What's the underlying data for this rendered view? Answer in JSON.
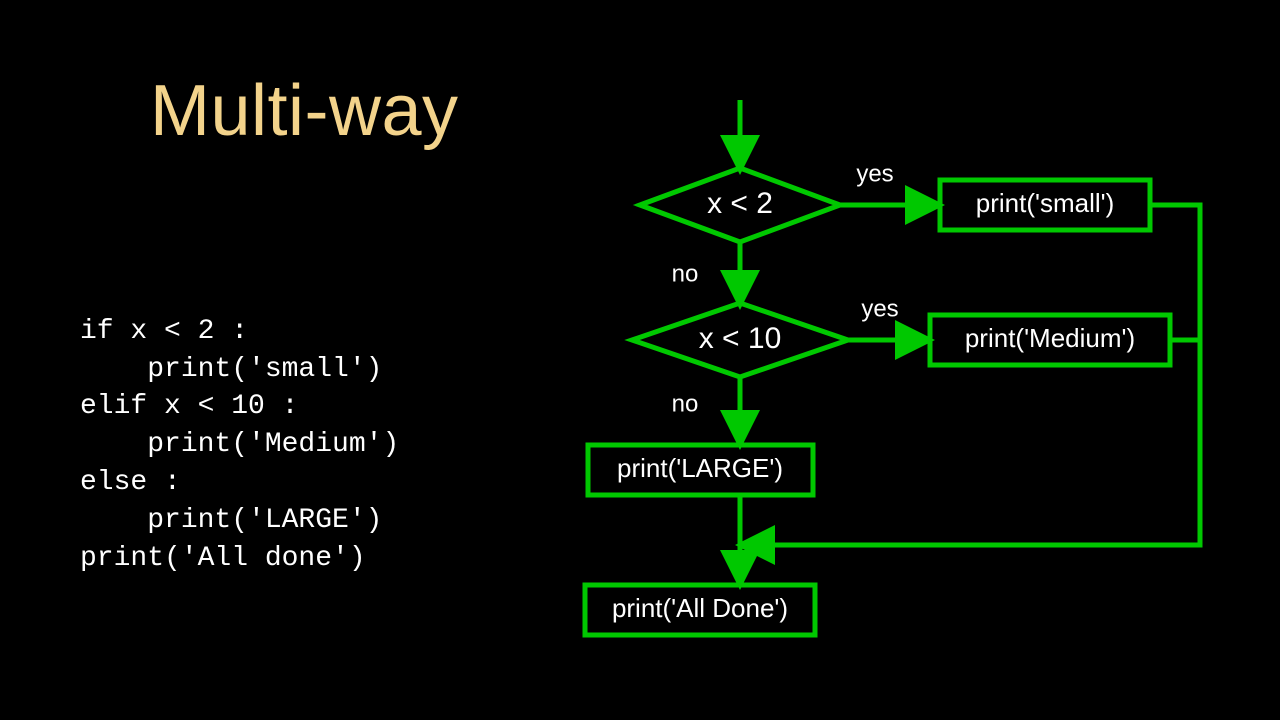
{
  "title": "Multi-way",
  "code": {
    "line1": "if x < 2 :",
    "line2": "    print('small')",
    "line3": "elif x < 10 :",
    "line4": "    print('Medium')",
    "line5": "else :",
    "line6": "    print('LARGE')",
    "line7": "print('All done')"
  },
  "flow": {
    "dec1": "x < 2",
    "dec2": "x < 10",
    "yes1": "yes",
    "yes2": "yes",
    "no1": "no",
    "no2": "no",
    "box1": "print('small')",
    "box2": "print('Medium')",
    "box3": "print('LARGE')",
    "box4": "print('All Done')"
  },
  "colors": {
    "title": "#f3d38b",
    "flow": "#00c800",
    "text": "#ffffff",
    "bg": "#000000"
  }
}
